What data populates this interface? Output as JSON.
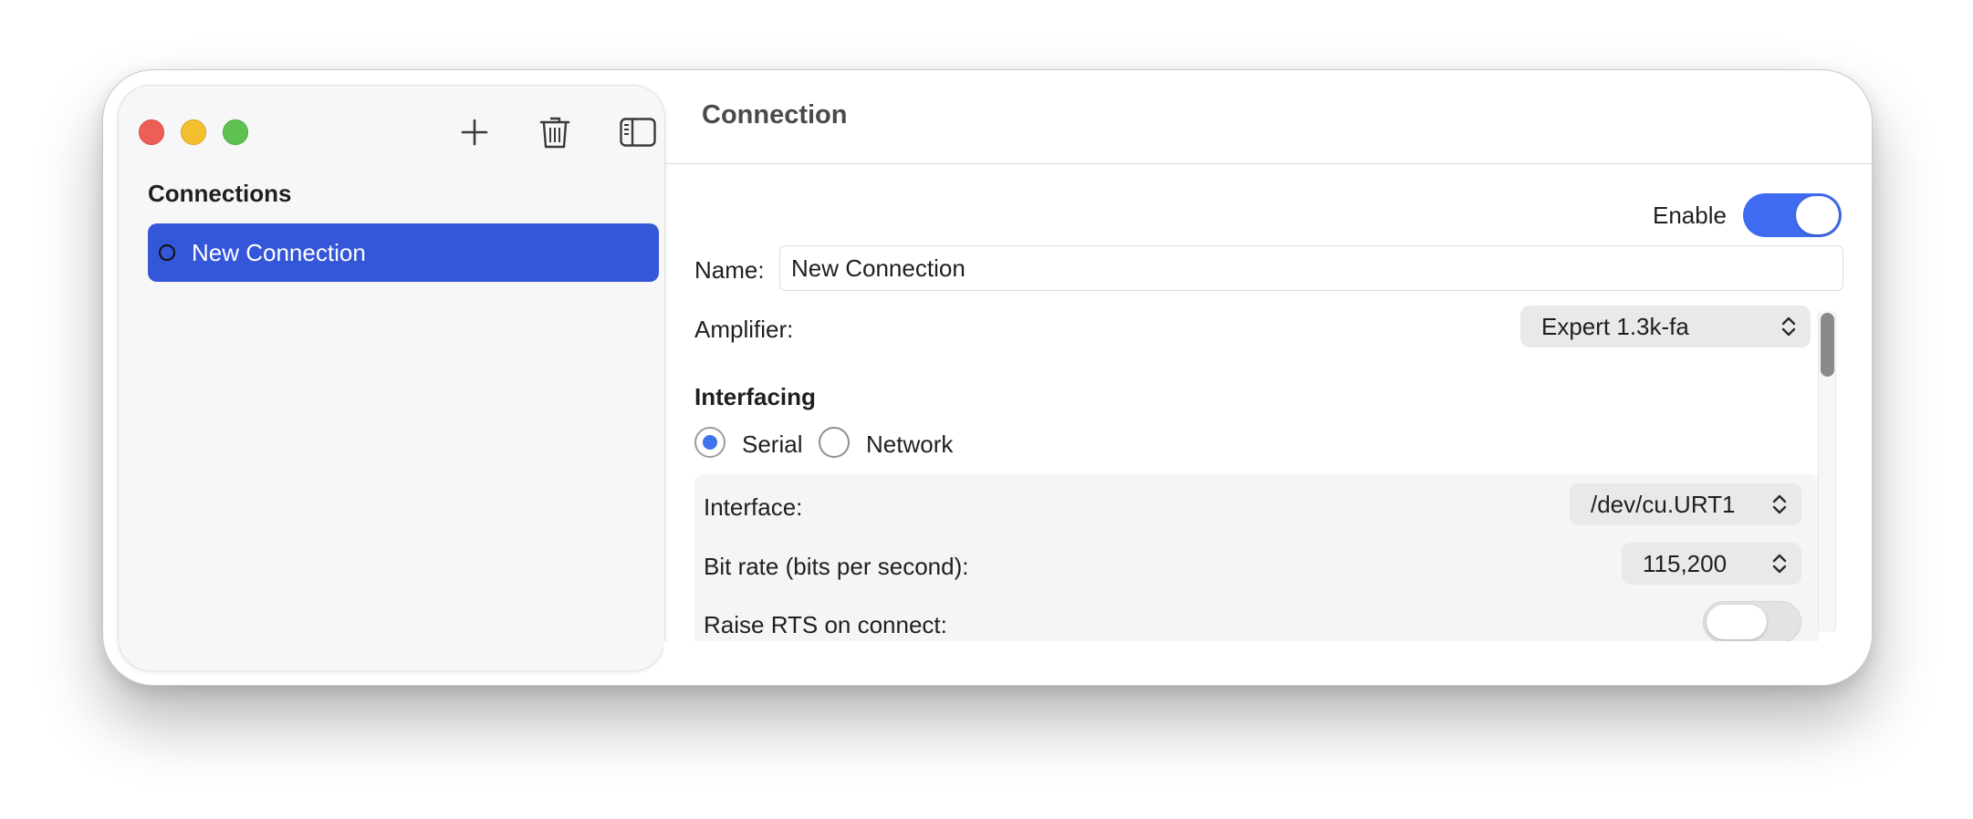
{
  "sidebar": {
    "heading": "Connections",
    "toolbar": {
      "add_icon": "plus-icon",
      "delete_icon": "trash-icon",
      "toggle_sidebar_icon": "sidebar-icon"
    },
    "items": [
      {
        "label": "New Connection",
        "selected": true,
        "status_icon": "circle-outline-icon"
      }
    ]
  },
  "detail": {
    "title": "Connection",
    "enable": {
      "label": "Enable",
      "on": true
    },
    "name": {
      "label": "Name:",
      "value": "New Connection"
    },
    "amplifier": {
      "label": "Amplifier:",
      "value": "Expert 1.3k-fa"
    },
    "interfacing": {
      "heading": "Interfacing",
      "options": [
        {
          "label": "Serial",
          "selected": true
        },
        {
          "label": "Network",
          "selected": false
        }
      ],
      "interface": {
        "label": "Interface:",
        "value": "/dev/cu.URT1"
      },
      "bit_rate": {
        "label": "Bit rate (bits per second):",
        "value": "115,200"
      },
      "raise_rts": {
        "label": "Raise RTS on connect:",
        "on": false
      }
    }
  },
  "colors": {
    "accent": "#3456d8",
    "toggle_on": "#3e6bf0",
    "radio_selected": "#3e73ec",
    "close": "#ec5f57",
    "minimize": "#f4bf2f",
    "zoom": "#5dc24f"
  }
}
